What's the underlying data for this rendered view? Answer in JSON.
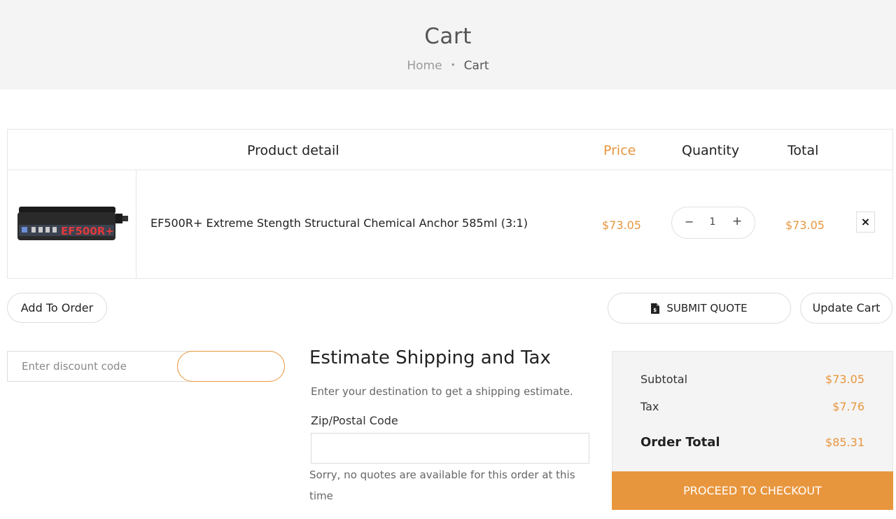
{
  "page": {
    "title": "Cart",
    "breadcrumb": {
      "home": "Home",
      "separator": "•",
      "current": "Cart"
    }
  },
  "table": {
    "headers": {
      "product": "Product detail",
      "price": "Price",
      "quantity": "Quantity",
      "total": "Total"
    },
    "items": [
      {
        "name": "EF500R+ Extreme Stength Structural Chemical Anchor 585ml (3:1)",
        "price": "$73.05",
        "quantity": "1",
        "total": "$73.05",
        "remove": "×",
        "image_label": "EF500R+"
      }
    ]
  },
  "actions": {
    "add_to_order": "Add To Order",
    "submit_quote": "SUBMIT QUOTE",
    "update_cart": "Update Cart",
    "minus": "−",
    "plus": "+"
  },
  "discount": {
    "placeholder": "Enter discount code",
    "apply_label": ""
  },
  "shipping": {
    "title": "Estimate Shipping and Tax",
    "description": "Enter your destination to get a shipping estimate.",
    "zip_label": "Zip/Postal Code",
    "zip_value": "",
    "notice": "Sorry, no quotes are available for this order at this time"
  },
  "summary": {
    "subtotal_label": "Subtotal",
    "subtotal": "$73.05",
    "tax_label": "Tax",
    "tax": "$7.76",
    "order_total_label": "Order Total",
    "order_total": "$85.31",
    "checkout": "PROCEED TO CHECKOUT"
  },
  "colors": {
    "accent": "#e8963e",
    "hero_bg": "#f4f4f4",
    "border": "#e6e6e6"
  },
  "icons": {
    "submit_quote": "document-dollar-icon",
    "remove": "close-icon"
  }
}
